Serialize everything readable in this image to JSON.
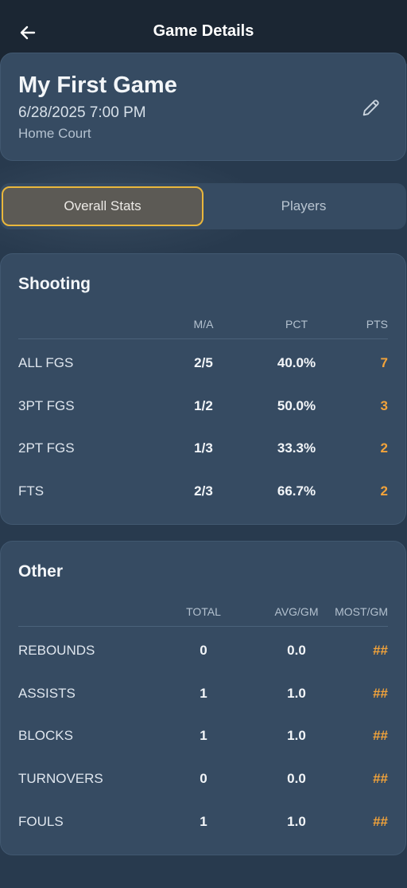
{
  "header": {
    "title": "Game Details"
  },
  "game": {
    "title": "My First Game",
    "datetime": "6/28/2025 7:00 PM",
    "location": "Home Court"
  },
  "tabs": {
    "overall": "Overall Stats",
    "players": "Players"
  },
  "shooting": {
    "title": "Shooting",
    "columns": [
      "M/A",
      "PCT",
      "PTS"
    ],
    "rows": [
      {
        "label": "ALL FGS",
        "ma": "2/5",
        "pct": "40.0%",
        "pts": "7"
      },
      {
        "label": "3PT FGS",
        "ma": "1/2",
        "pct": "50.0%",
        "pts": "3"
      },
      {
        "label": "2PT FGS",
        "ma": "1/3",
        "pct": "33.3%",
        "pts": "2"
      },
      {
        "label": "FTS",
        "ma": "2/3",
        "pct": "66.7%",
        "pts": "2"
      }
    ]
  },
  "other": {
    "title": "Other",
    "columns": [
      "TOTAL",
      "AVG/GM",
      "MOST/GM"
    ],
    "rows": [
      {
        "label": "REBOUNDS",
        "total": "0",
        "avg": "0.0",
        "most": "##"
      },
      {
        "label": "ASSISTS",
        "total": "1",
        "avg": "1.0",
        "most": "##"
      },
      {
        "label": "BLOCKS",
        "total": "1",
        "avg": "1.0",
        "most": "##"
      },
      {
        "label": "TURNOVERS",
        "total": "0",
        "avg": "0.0",
        "most": "##"
      },
      {
        "label": "FOULS",
        "total": "1",
        "avg": "1.0",
        "most": "##"
      }
    ]
  },
  "colors": {
    "accent": "#f2a33a",
    "tab_border": "#e9b73c"
  }
}
